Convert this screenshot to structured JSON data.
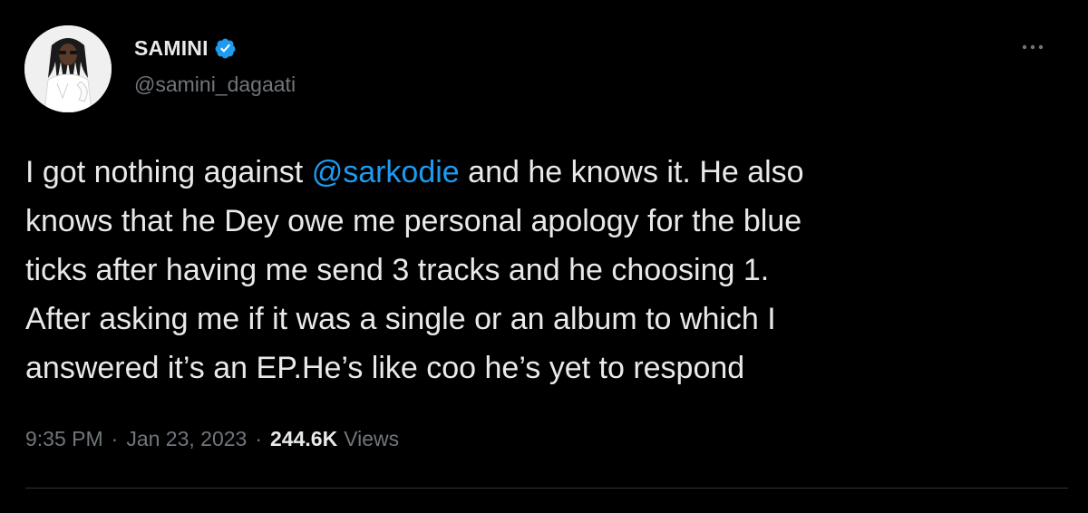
{
  "author": {
    "display_name": "SAMINI",
    "handle": "@samini_dagaati",
    "verified": true,
    "verified_color": "#1d9bf0"
  },
  "tweet": {
    "text_before_mention": "I got nothing against ",
    "mention": "@sarkodie",
    "text_after_mention": " and he knows it. He also\nknows that he Dey owe me personal apology for the blue\nticks after having me send 3 tracks and he choosing 1.\nAfter asking me if it was a single or an album to which I\nanswered it’s an EP.He’s like coo he’s yet to respond"
  },
  "meta": {
    "time": "9:35 PM",
    "separator": "·",
    "date": "Jan 23, 2023",
    "views_count": "244.6K",
    "views_label": "Views"
  },
  "icons": {
    "verified": "verified-badge-icon",
    "more": "more-options-icon"
  },
  "colors": {
    "background": "#000000",
    "primary_text": "#e7e9ea",
    "secondary_text": "#71767b",
    "link": "#1d9bf0"
  }
}
